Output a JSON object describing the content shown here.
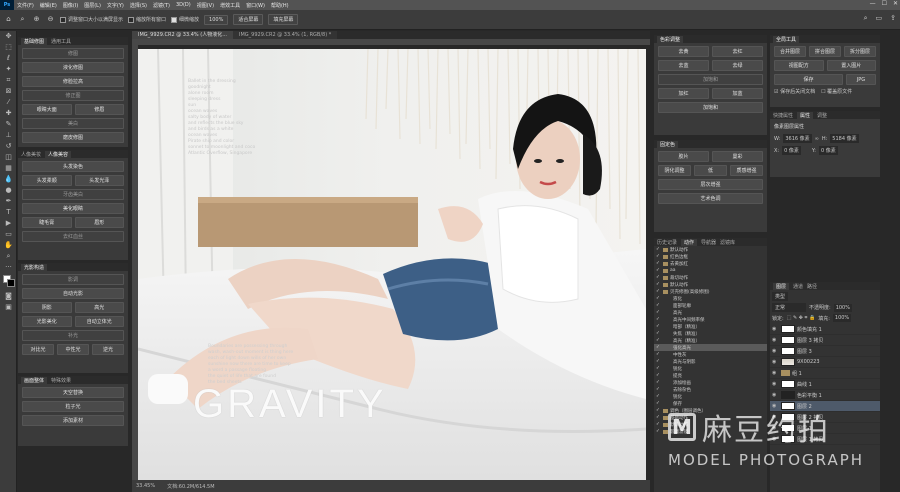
{
  "menu": {
    "app_icon": "Ps",
    "items": [
      "文件(F)",
      "编辑(E)",
      "图像(I)",
      "图层(L)",
      "文字(Y)",
      "选择(S)",
      "滤镜(T)",
      "3D(D)",
      "视图(V)",
      "增效工具",
      "窗口(W)",
      "帮助(H)"
    ]
  },
  "window_controls": [
    "—",
    "☐",
    "✕"
  ],
  "options": {
    "resize_window": "调整窗口大小以满屏显示",
    "zoom_all": "缩放所有窗口",
    "scrubby_zoom": "细微缩放",
    "zoom_value": "100%",
    "fit_screen": "适合屏幕",
    "fill_screen": "填充屏幕"
  },
  "document": {
    "tab_label": "IMG_9929.CR2 @ 33.4% (人物液化...",
    "tab2_label": "IMG_9929.CR2 @ 33.4% (1, RGB/8) *",
    "status_zoom": "33.45%",
    "status_doc": "文档:60.2M/614.5M"
  },
  "left_panels": {
    "p1": {
      "tabs": [
        "基础修图",
        "通用工具"
      ],
      "buttons": [
        "液化修图",
        "画笔工具",
        "修脸拉高",
        "修图",
        "眼睛大面",
        "修正图",
        "修眉",
        "美白",
        "磨皮修图",
        "高光磨皮",
        "眼袋处理",
        "肤色工具",
        "提亮肤色",
        "去油光",
        "调色",
        "细节"
      ]
    },
    "p2": {
      "tabs": [
        "人像美妆",
        "人像美容"
      ],
      "buttons": [
        "头发染色",
        "头发柔顺",
        "头发光泽",
        "美化眼睛",
        "睫毛膏",
        "眉形",
        "唇彩",
        "腮红",
        "牙齿美白",
        "美容装饰",
        "去红血丝"
      ]
    },
    "p3": {
      "tabs": [
        "光影构造"
      ],
      "buttons": [
        "自动光影",
        "影调",
        "制造高光",
        "阴影",
        "高光",
        "光影结构",
        "光影美化",
        "自动立体光",
        "补光",
        "加强",
        "对比光",
        "顶光",
        "中性光",
        "柔光",
        "逆光"
      ]
    },
    "p4": {
      "tabs": [
        "画面整体",
        "特殊效果"
      ],
      "buttons": [
        "天空替换",
        "氛围",
        "粒子光",
        "添加素材"
      ]
    }
  },
  "mid_panels": {
    "p1": {
      "title": "色彩调整",
      "buttons": [
        "去黄",
        "去红",
        "去蓝",
        "去绿",
        "加红",
        "加蓝",
        "加饱和"
      ]
    },
    "p2": {
      "title": "固定色",
      "buttons": [
        "胶片",
        "曼彩",
        "阴化调整",
        "低",
        "质感增强",
        "层次增强",
        "艺术色调"
      ]
    },
    "history_tabs": [
      "历史记录",
      "动作",
      "导航器",
      "滤镜库"
    ],
    "actions": [
      {
        "label": "默认动作",
        "folder": true
      },
      {
        "label": "红色边框",
        "folder": true
      },
      {
        "label": "去黄加红",
        "folder": true
      },
      {
        "label": "aa",
        "folder": true
      },
      {
        "label": "裁切动作",
        "folder": true
      },
      {
        "label": "默认动作",
        "folder": true
      },
      {
        "label": "贝壳修图(高级修图)",
        "folder": true
      },
      {
        "label": "液化"
      },
      {
        "label": "面部轮廓"
      },
      {
        "label": "高光"
      },
      {
        "label": "高光中间频率保"
      },
      {
        "label": "暗部（精准）"
      },
      {
        "label": "失焦（精准）"
      },
      {
        "label": "高光（精准）"
      },
      {
        "label": "强化高光",
        "selected": true
      },
      {
        "label": "中性灰"
      },
      {
        "label": "高光与阴影"
      },
      {
        "label": "锐化"
      },
      {
        "label": "提亮"
      },
      {
        "label": "添加绘画"
      },
      {
        "label": "去除杂色"
      },
      {
        "label": "锐化"
      },
      {
        "label": "保存"
      },
      {
        "label": "调色（图层调色）",
        "folder": true
      },
      {
        "label": "基础动作",
        "folder": true
      },
      {
        "label": "默认动作",
        "folder": true
      },
      {
        "label": "影调滤镜",
        "folder": true
      }
    ]
  },
  "right_panels": {
    "tools": {
      "title": "全局工具",
      "buttons": [
        "合并图层",
        "拼合图层",
        "拆分图层",
        "视图配方",
        "置入图片"
      ],
      "save": "保存",
      "format": "JPG",
      "check1": "保存后关闭文档",
      "check2": "覆盖原文件"
    },
    "properties": {
      "tabs": [
        "快捷属性",
        "属性",
        "调整"
      ],
      "section": "像素图层属性",
      "w_label": "W:",
      "w_value": "3616 像素",
      "h_label": "H:",
      "h_value": "5184 像素",
      "x_label": "X:",
      "x_value": "0 像素",
      "y_label": "Y:",
      "y_value": "0 像素"
    },
    "layers": {
      "tabs": [
        "图层",
        "通道",
        "路径"
      ],
      "kind": "类型",
      "blend": "正常",
      "opacity_label": "不透明度:",
      "opacity": "100%",
      "fill_label": "填充:",
      "fill": "100%",
      "lock_label": "锁定:",
      "rows": [
        {
          "name": "颜色填充 1",
          "thumb": "white"
        },
        {
          "name": "图层 3 拷贝",
          "thumb": "white"
        },
        {
          "name": "图层 3",
          "thumb": "white"
        },
        {
          "name": "9X00223",
          "thumb": "img"
        },
        {
          "name": "组 1",
          "thumb": "folder"
        },
        {
          "name": "曲线 1",
          "thumb": "white"
        },
        {
          "name": "色彩平衡 1",
          "thumb": "dark"
        },
        {
          "name": "图层 2",
          "thumb": "white",
          "selected": true
        },
        {
          "name": "图层 2 拷贝",
          "thumb": "white"
        },
        {
          "name": "图层 1",
          "thumb": "white"
        },
        {
          "name": "图层 1 拷贝",
          "thumb": "white"
        }
      ]
    }
  },
  "photo": {
    "big_text": "GRAVITY",
    "small_lines_top": [
      "Ballet in the dressing",
      "goodnight",
      "alone room",
      "sleeping dress",
      "sun",
      "ocean waves",
      "salty body of water",
      "and reflects the blue sky",
      "and birds as a white",
      "ocean waves",
      "Pirate ship and color",
      "sonnet to moonlight and coco",
      "Atlantic Overflow, Singapore"
    ],
    "small_lines_mid": [
      "Boundaries are possessing through",
      "wash, wash-out moment is thing here",
      "each of light down wills of her own",
      "sunshine now there are time to keep",
      "a word a passage floating",
      "the quiet of life that are found",
      "the bed sheets"
    ]
  },
  "watermark": {
    "brand": "麻豆约拍",
    "sub": "MODEL PHOTOGRAPH"
  }
}
